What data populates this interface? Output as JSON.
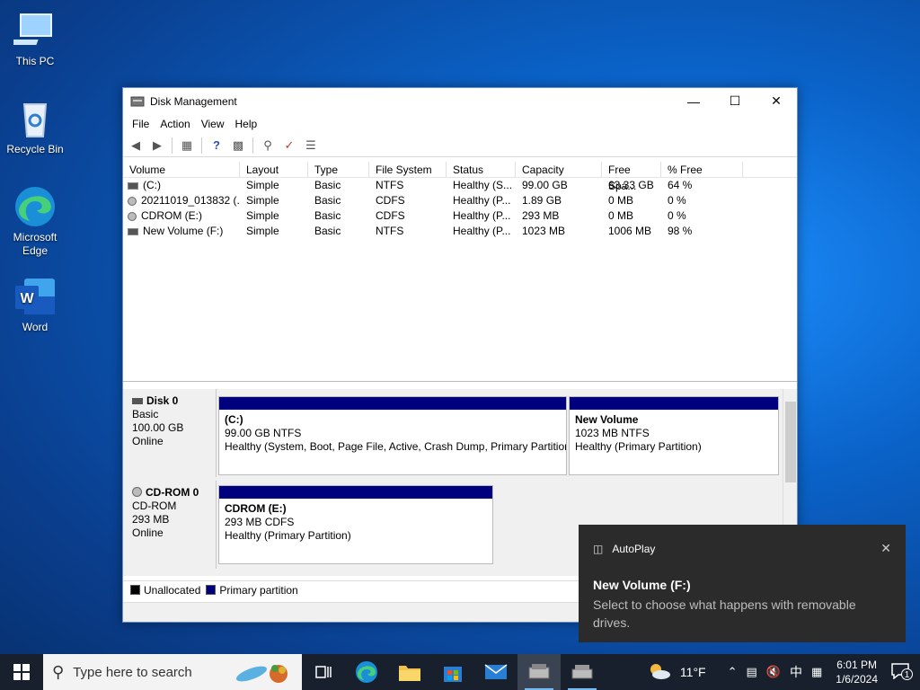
{
  "desktop": {
    "icons": [
      {
        "label": "This PC"
      },
      {
        "label": "Recycle Bin"
      },
      {
        "label": "Microsoft Edge"
      },
      {
        "label": "Word"
      }
    ]
  },
  "window": {
    "title": "Disk Management",
    "menus": [
      "File",
      "Action",
      "View",
      "Help"
    ],
    "columns": [
      "Volume",
      "Layout",
      "Type",
      "File System",
      "Status",
      "Capacity",
      "Free Spa...",
      "% Free"
    ],
    "volumes": [
      {
        "volume": "(C:)",
        "layout": "Simple",
        "type": "Basic",
        "fs": "NTFS",
        "status": "Healthy (S...",
        "capacity": "99.00 GB",
        "free": "63.33 GB",
        "pct": "64 %"
      },
      {
        "volume": "20211019_013832 (...",
        "layout": "Simple",
        "type": "Basic",
        "fs": "CDFS",
        "status": "Healthy (P...",
        "capacity": "1.89 GB",
        "free": "0 MB",
        "pct": "0 %"
      },
      {
        "volume": "CDROM (E:)",
        "layout": "Simple",
        "type": "Basic",
        "fs": "CDFS",
        "status": "Healthy (P...",
        "capacity": "293 MB",
        "free": "0 MB",
        "pct": "0 %"
      },
      {
        "volume": "New Volume (F:)",
        "layout": "Simple",
        "type": "Basic",
        "fs": "NTFS",
        "status": "Healthy (P...",
        "capacity": "1023 MB",
        "free": "1006 MB",
        "pct": "98 %"
      }
    ],
    "disks": {
      "disk0": {
        "name": "Disk 0",
        "kind": "Basic",
        "size": "100.00 GB",
        "state": "Online"
      },
      "cdrom0": {
        "name": "CD-ROM 0",
        "kind": "CD-ROM",
        "size": "293 MB",
        "state": "Online"
      }
    },
    "partitions": {
      "c": {
        "name": "(C:)",
        "size": "99.00 GB NTFS",
        "status": "Healthy (System, Boot, Page File, Active, Crash Dump, Primary Partition"
      },
      "newvol": {
        "name": "New Volume",
        "size": "1023 MB NTFS",
        "status": "Healthy (Primary Partition)"
      },
      "cdrom": {
        "name": "CDROM  (E:)",
        "size": "293 MB CDFS",
        "status": "Healthy (Primary Partition)"
      }
    },
    "legend": {
      "unallocated": "Unallocated",
      "primary": "Primary partition"
    }
  },
  "toast": {
    "app": "AutoPlay",
    "title": "New Volume (F:)",
    "body": "Select to choose what happens with removable drives."
  },
  "taskbar": {
    "search_placeholder": "Type here to search",
    "weather": "11°F",
    "ime": "中",
    "time": "6:01 PM",
    "date": "1/6/2024",
    "notification_count": "1"
  },
  "colors": {
    "partition_bar": "#00007f",
    "taskbar": "#17202c",
    "toast": "#2b2b2b"
  }
}
